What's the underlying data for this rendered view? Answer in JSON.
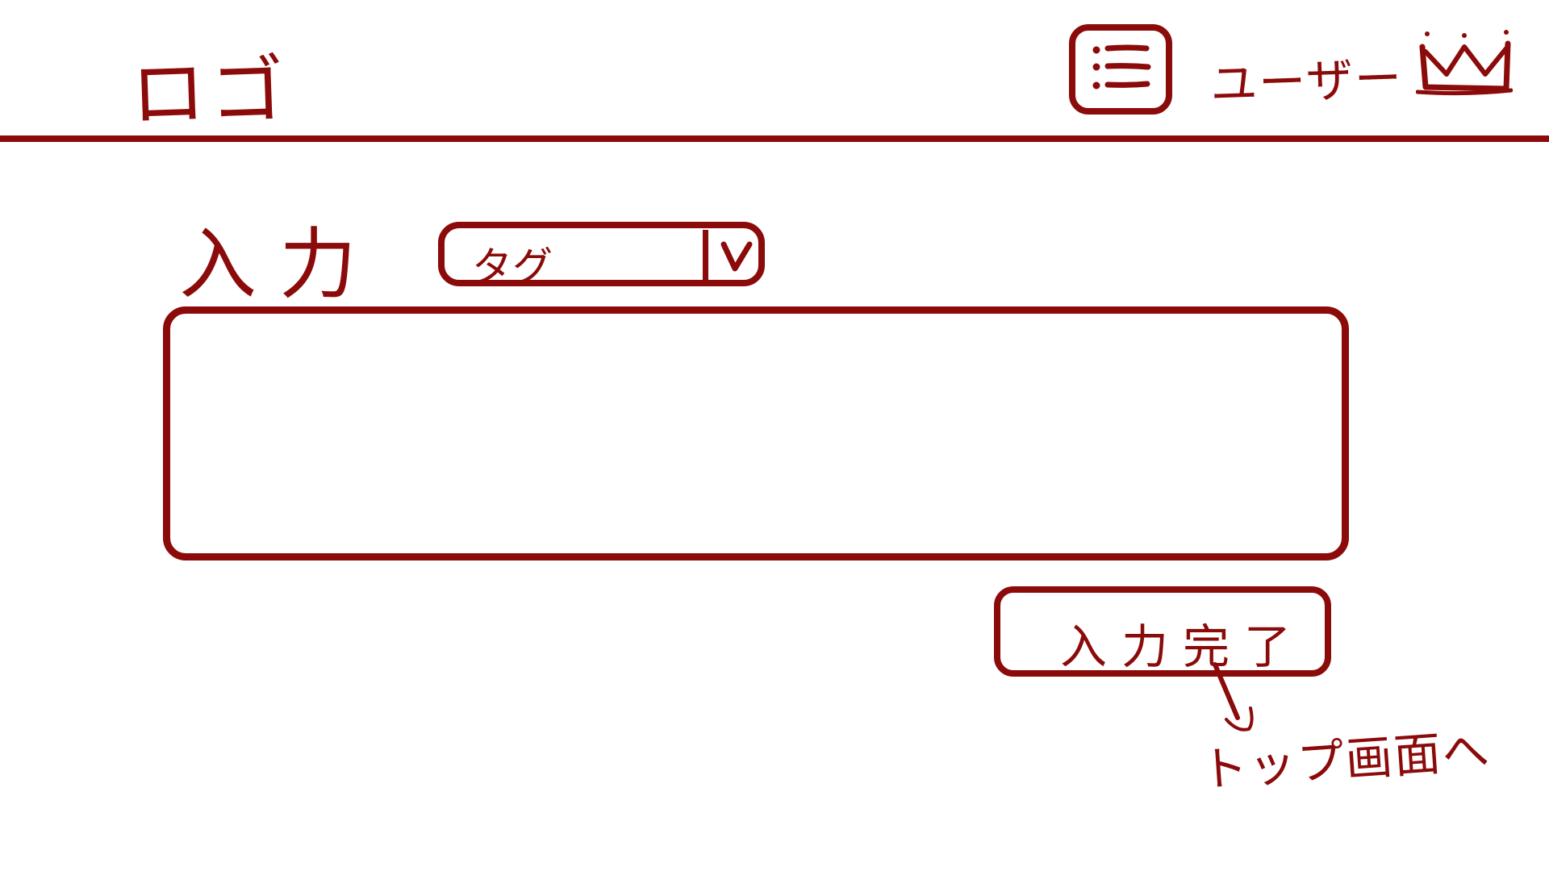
{
  "header": {
    "logo_text": "ロゴ",
    "menu_icon": "menu-list-icon",
    "username": "ユーザー",
    "user_icon": "crown-icon"
  },
  "form": {
    "title": "入力",
    "tag_select": {
      "selected": "タグ",
      "chevron_icon": "chevron-down-icon"
    },
    "text_area": {
      "value": "",
      "placeholder": ""
    },
    "submit_label": "入力完了"
  },
  "annotation": {
    "arrow_icon": "arrow-down-icon",
    "note": "トップ画面へ"
  },
  "colors": {
    "stroke": "#8b0a0a",
    "background": "#ffffff"
  }
}
